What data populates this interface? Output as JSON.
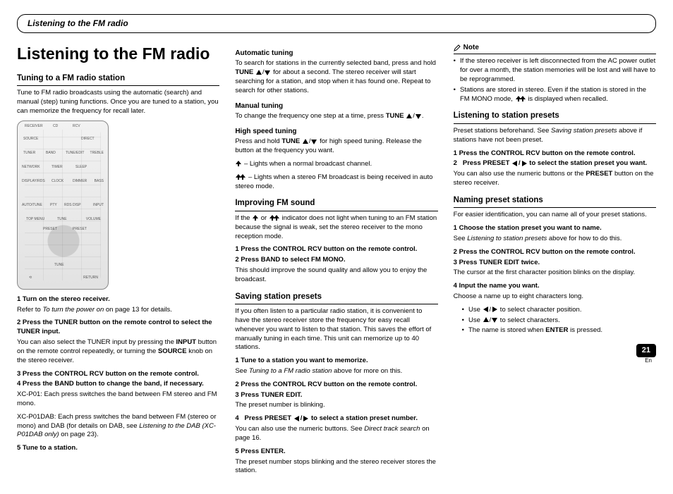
{
  "header": {
    "title": "Listening to the FM radio"
  },
  "main_title": "Listening to the FM radio",
  "col1": {
    "h_tuning": "Tuning to a FM radio station",
    "p_intro": "Tune to FM radio broadcasts using the automatic (search) and manual (step) tuning functions. Once you are tuned to a station, you can memorize the frequency for recall later.",
    "s1": "1   Turn on the stereo receiver.",
    "s1_sub_a": "Refer to ",
    "s1_sub_i": "To turn the power on",
    "s1_sub_b": " on page 13 for details.",
    "s2": "2   Press the TUNER button on the remote control to select the TUNER input.",
    "s2_sub": "You can also select the TUNER input by pressing the ",
    "s2_sub_b1": "INPUT",
    "s2_sub2": " button on the remote control repeatedly, or turning the ",
    "s2_sub_b2": "SOURCE",
    "s2_sub3": " knob on the stereo receiver.",
    "s3": "3   Press the CONTROL RCV button on the remote control.",
    "s4": "4   Press the BAND button to change the band, if necessary.",
    "s4_sub1": "XC-P01: Each press switches the band between FM stereo and FM mono.",
    "s4_sub2_a": "XC-P01DAB: Each press switches the band between FM (stereo or mono) and DAB (for details on DAB, see ",
    "s4_sub2_i": "Listening to the DAB (XC-P01DAB only)",
    "s4_sub2_b": " on page 23).",
    "s5": "5   Tune to a station."
  },
  "col2": {
    "h_auto": "Automatic tuning",
    "p_auto_a": "To search for stations in the currently selected band, press and hold ",
    "p_auto_b": "TUNE ",
    "p_auto_c": " for about a second. The stereo receiver will start searching for a station, and stop when it has found one. Repeat to search for other stations.",
    "h_man": "Manual tuning",
    "p_man_a": "To change the frequency one step at a time, press ",
    "p_man_b": "TUNE ",
    "p_man_c": ".",
    "h_hst": "High speed tuning",
    "p_hst_a": "Press and hold ",
    "p_hst_b": "TUNE ",
    "p_hst_c": " for high speed tuning. Release the button at the frequency you want.",
    "ind1": " – Lights when a normal broadcast channel.",
    "ind2": " – Lights when a stereo FM broadcast is being received in auto stereo mode.",
    "h_imp": "Improving FM sound",
    "p_imp": "If the  or  indicator does not light when tuning to an FM station because the signal is weak, set the stereo receiver to the mono reception mode.",
    "imp_s1": "1   Press the CONTROL RCV button on the remote control.",
    "imp_s2": "2   Press BAND to select FM MONO.",
    "imp_p2": "This should improve the sound quality and allow you to enjoy the broadcast.",
    "h_save": "Saving station presets",
    "p_save": "If you often listen to a particular radio station, it is convenient to have the stereo receiver store the frequency for easy recall whenever you want to listen to that station. This saves the effort of manually tuning in each time. This unit can memorize up to 40 stations.",
    "sv_s1": "1   Tune to a station you want to memorize.",
    "sv_s1_sub_a": "See ",
    "sv_s1_sub_i": "Tuning to a FM radio station",
    "sv_s1_sub_b": " above for more on this.",
    "sv_s2": "2   Press the CONTROL RCV button on the remote control.",
    "sv_s3": "3   Press TUNER EDIT.",
    "sv_s3_sub": "The preset number is blinking.",
    "sv_s4": "4   Press PRESET / to select a station preset number.",
    "sv_s4_sub_a": "You can also use the numeric buttons. See ",
    "sv_s4_sub_i": "Direct track search",
    "sv_s4_sub_b": " on page 16.",
    "sv_s5": "5   Press ENTER.",
    "sv_s5_sub": "The preset number stops blinking and the stereo receiver stores the station."
  },
  "col3": {
    "note_label": "Note",
    "note1": "If the stereo receiver is left disconnected from the AC power outlet for over a month, the station memories will be lost and will have to be reprogrammed.",
    "note2": "Stations are stored in stereo. Even if the station is stored in the FM MONO mode,  is displayed when recalled.",
    "h_listen": "Listening to station presets",
    "p_listen_a": "Preset stations beforehand. See ",
    "p_listen_i": "Saving station presets",
    "p_listen_b": " above if stations have not been preset.",
    "ls_s1": "1   Press the CONTROL RCV button on the remote control.",
    "ls_s2": "2   Press PRESET / to select the station preset you want.",
    "ls_sub_a": "You can also use the numeric buttons or the ",
    "ls_sub_b": "PRESET",
    "ls_sub_c": " button on the stereo receiver.",
    "h_name": "Naming preset stations",
    "p_name": "For easier identification, you can name all of your preset stations.",
    "nm_s1": "1   Choose the station preset you want to name.",
    "nm_s1_sub_a": "See ",
    "nm_s1_sub_i": "Listening to station presets",
    "nm_s1_sub_b": " above for how to do this.",
    "nm_s2": "2   Press the CONTROL RCV button on the remote control.",
    "nm_s3": "3   Press TUNER EDIT twice.",
    "nm_s3_sub": "The cursor at the first character position blinks on the display.",
    "nm_s4": "4   Input the name you want.",
    "nm_s4_sub": "Choose a name up to eight characters long.",
    "nm_b1": "Use / to select character position.",
    "nm_b2": "Use / to select characters.",
    "nm_b3_a": "The name is stored when ",
    "nm_b3_b": "ENTER",
    "nm_b3_c": " is pressed."
  },
  "page_number": "21",
  "page_lang": "En"
}
